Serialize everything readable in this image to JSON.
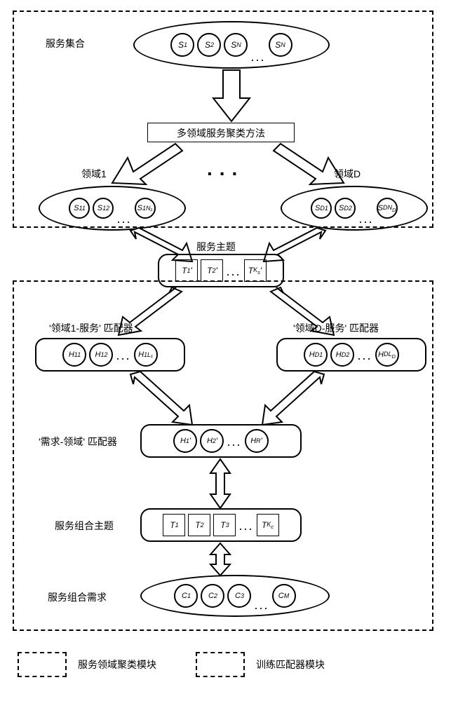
{
  "labels": {
    "serviceSet": "服务集合",
    "clusterMethod": "多领域服务聚类方法",
    "domain1": "领域1",
    "domainD": "领域D",
    "serviceTopic": "服务主题",
    "matcher1": "'领域1-服务' 匹配器",
    "matcherD": "'领域D-服务' 匹配器",
    "demandMatcher": "'需求-领域' 匹配器",
    "comboTopic": "服务组合主题",
    "comboDemand": "服务组合需求",
    "legendCluster": "服务领域聚类模块",
    "legendTrain": "训练匹配器模块"
  },
  "serviceSet": [
    "S₁",
    "S₂",
    "Sₙ",
    "Sₙ"
  ],
  "domain1Items": [
    "S₁₁",
    "S₁₂",
    "S₁ₙ₁"
  ],
  "domainDItems": [
    "S_D1",
    "S_D2",
    "S_DN_D"
  ],
  "serviceTopics": [
    "T₁'",
    "T₂'",
    "T_Ks'"
  ],
  "matcher1Items": [
    "H₁₁",
    "H₁₂",
    "H₁L₁"
  ],
  "matcherDItems": [
    "H_D1",
    "H_D2",
    "H_DL_D"
  ],
  "demandMatcherItems": [
    "H₁'",
    "H₂'",
    "H_R'"
  ],
  "comboTopics": [
    "T₁",
    "T₂",
    "T₃",
    "T_Kc"
  ],
  "comboDemands": [
    "C₁",
    "C₂",
    "C₃",
    "C_M"
  ]
}
